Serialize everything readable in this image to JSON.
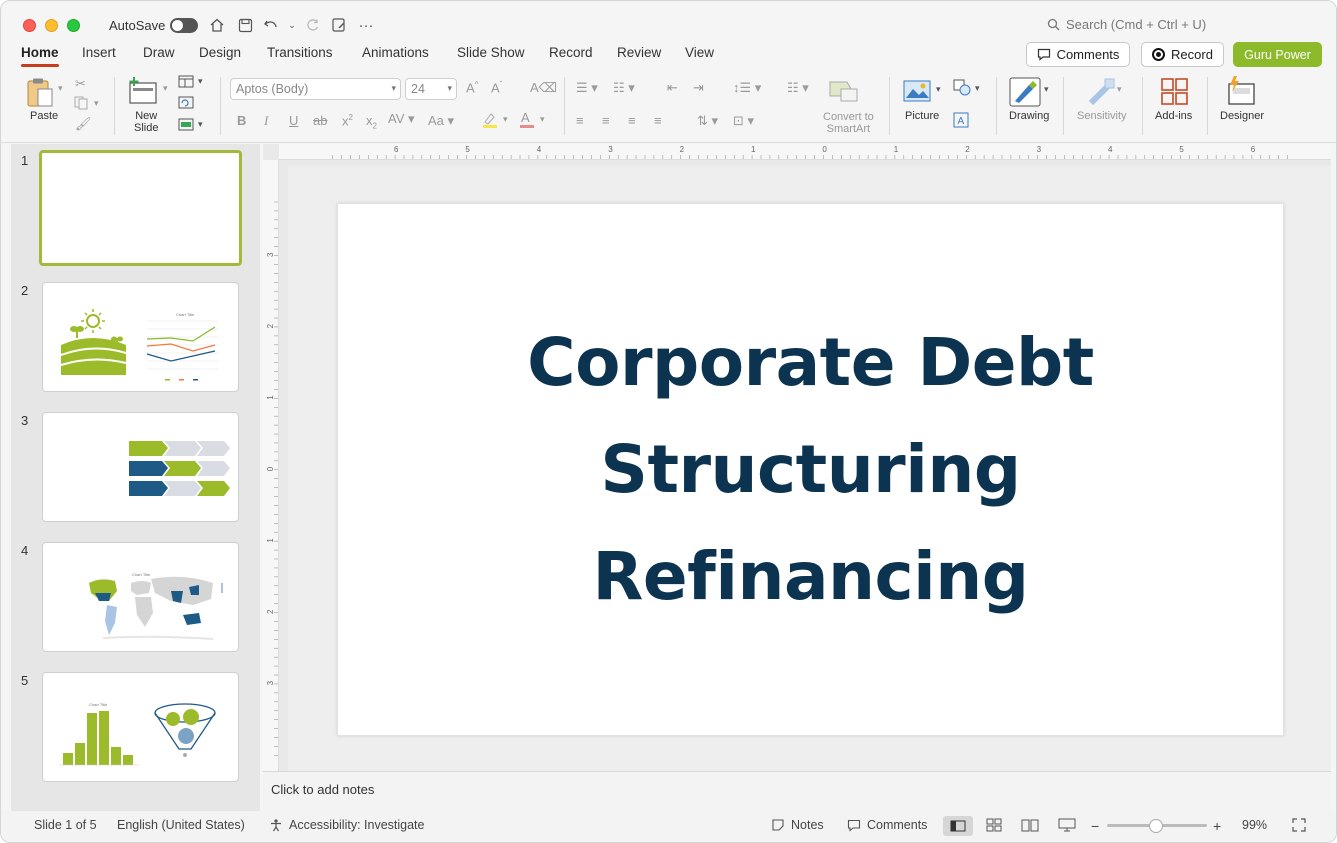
{
  "titlebar": {
    "autosave_label": "AutoSave",
    "search_placeholder": "Search (Cmd + Ctrl + U)"
  },
  "tabs": [
    "Home",
    "Insert",
    "Draw",
    "Design",
    "Transitions",
    "Animations",
    "Slide Show",
    "Record",
    "Review",
    "View"
  ],
  "header_buttons": {
    "comments": "Comments",
    "record": "Record",
    "guru": "Guru Power"
  },
  "ribbon": {
    "paste": "Paste",
    "new_slide_line1": "New",
    "new_slide_line2": "Slide",
    "font_name": "Aptos (Body)",
    "font_size": "24",
    "convert_line1": "Convert to",
    "convert_line2": "SmartArt",
    "picture": "Picture",
    "drawing": "Drawing",
    "sensitivity": "Sensitivity",
    "addins": "Add-ins",
    "designer": "Designer"
  },
  "thumbnails": {
    "numbers": [
      "1",
      "2",
      "3",
      "4",
      "5"
    ],
    "chart_title": "Chart Title"
  },
  "slide": {
    "title_line1": "Corporate Debt",
    "title_line2": "Structuring",
    "title_line3": "Refinancing",
    "title_color": "#0c3450"
  },
  "ruler": {
    "h_labels": [
      "6",
      "5",
      "4",
      "3",
      "2",
      "1",
      "0",
      "1",
      "2",
      "3",
      "4",
      "5",
      "6"
    ],
    "v_labels": [
      "3",
      "2",
      "1",
      "0",
      "1",
      "2",
      "3"
    ]
  },
  "notes": {
    "placeholder": "Click to add notes"
  },
  "status": {
    "slide_counter": "Slide 1 of 5",
    "language": "English (United States)",
    "accessibility": "Accessibility: Investigate",
    "notes": "Notes",
    "comments": "Comments",
    "zoom": "99%"
  },
  "colors": {
    "accent_green": "#8cba2b",
    "navy": "#0c3450",
    "teal_blue": "#1e5a86",
    "tab_underline": "#c43e1c"
  }
}
